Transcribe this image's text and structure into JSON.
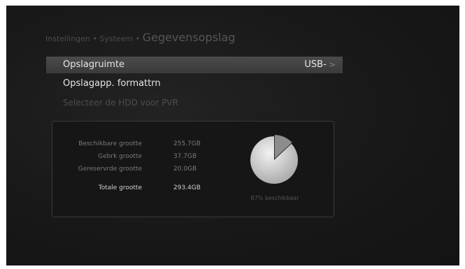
{
  "breadcrumb": {
    "item1": "Instellingen",
    "sep1": "•",
    "item2": "Systeem",
    "sep2": "•",
    "current": "Gegevensopslag"
  },
  "menu": {
    "items": [
      {
        "label": "Opslagruimte",
        "value": "USB-",
        "arrow": ">",
        "selected": true
      },
      {
        "label": "Opslagapp. formattrn"
      },
      {
        "label": "Selecteer de HDD voor PVR",
        "disabled": true
      }
    ]
  },
  "storage": {
    "available_label": "Beschikbare grootte",
    "available_value": "255.7GB",
    "used_label": "Gebrk grootte",
    "used_value": "37.7GB",
    "reserved_label": "Gereservrde grootte",
    "reserved_value": "20.0GB",
    "total_label": "Totale grootte",
    "total_value": "293.4GB",
    "available_fraction": 0.87,
    "pie_caption": "87% beschikbaar"
  },
  "colors": {
    "pie_available": "#d6d6d6",
    "pie_used": "#8c8c8c"
  }
}
